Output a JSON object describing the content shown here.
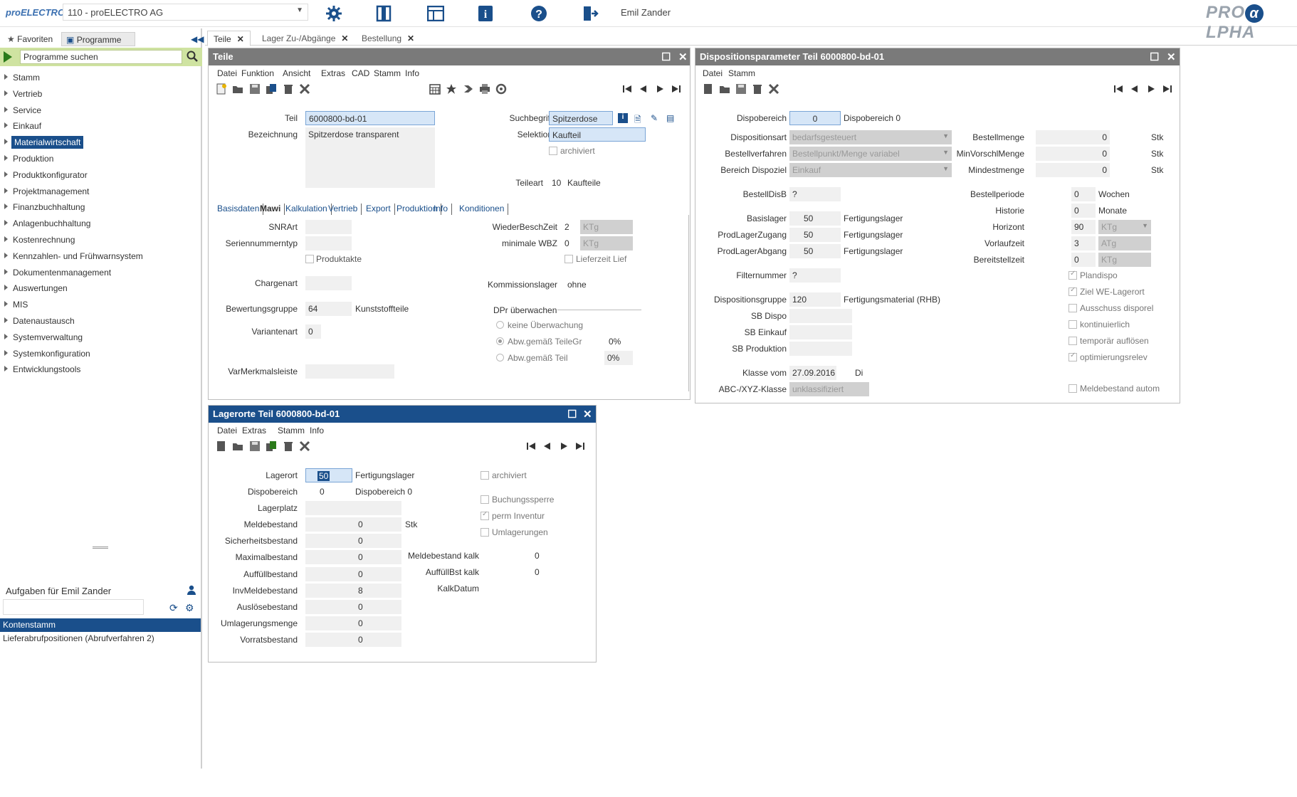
{
  "top": {
    "logo": "proELECTRO",
    "company": "110 - proELECTRO AG",
    "user": "Emil Zander",
    "brand_pre": "PRO",
    "brand_a": "α",
    "brand_post": "LPHA"
  },
  "left": {
    "tab_favorites": "Favoriten",
    "tab_programs": "Programme",
    "search_placeholder": "Programme suchen",
    "nav": [
      "Stamm",
      "Vertrieb",
      "Service",
      "Einkauf",
      "Materialwirtschaft",
      "Produktion",
      "Produktkonfigurator",
      "Projektmanagement",
      "Finanzbuchhaltung",
      "Anlagenbuchhaltung",
      "Kostenrechnung",
      "Kennzahlen- und Frühwarnsystem",
      "Dokumentenmanagement",
      "Auswertungen",
      "MIS",
      "Datenaustausch",
      "Systemverwaltung",
      "Systemkonfiguration",
      "Entwicklungstools"
    ],
    "tasks_title": "Aufgaben für Emil Zander",
    "tasks": [
      "Kontenstamm",
      "Lieferabrufpositionen (Abrufverfahren 2)"
    ]
  },
  "tabs": [
    "Teile",
    "Lager Zu-/Abgänge",
    "Bestellung"
  ],
  "teile": {
    "title": "Teile",
    "menu": [
      "Datei",
      "Funktion",
      "Ansicht",
      "Extras",
      "CAD",
      "Stamm",
      "Info"
    ],
    "teil_lbl": "Teil",
    "teil": "6000800-bd-01",
    "bez_lbl": "Bezeichnung",
    "bez": "Spitzerdose transparent",
    "such_lbl": "Suchbegriff",
    "such": "Spitzerdose",
    "sel_lbl": "Selektion",
    "sel": "Kaufteil",
    "archiviert": "archiviert",
    "teilart_lbl": "Teileart",
    "teilart": "10",
    "teilart_txt": "Kaufteile",
    "subtabs": [
      "Basisdaten",
      "Mawi",
      "Kalkulation",
      "Vertrieb",
      "Export",
      "Produktion",
      "Info",
      "Konditionen"
    ],
    "snr_lbl": "SNRArt",
    "sernr_lbl": "Seriennummerntyp",
    "produktakte": "Produktakte",
    "charg_lbl": "Chargenart",
    "bew_lbl": "Bewertungsgruppe",
    "bew": "64",
    "bew_txt": "Kunststoffteile",
    "var_lbl": "Variantenart",
    "var": "0",
    "varm_lbl": "VarMerkmalsleiste",
    "wbz_lbl": "WiederBeschZeit",
    "wbz": "2",
    "wbz_u": "KTg",
    "mwbz_lbl": "minimale WBZ",
    "mwbz": "0",
    "mwbz_u": "KTg",
    "lieferzeit": "Lieferzeit Lief",
    "kom_lbl": "Kommissionslager",
    "kom": "ohne",
    "dpr_lbl": "DPr überwachen",
    "r1": "keine Überwachung",
    "r2": "Abw.gemäß TeileGr",
    "r2v": "0%",
    "r3": "Abw.gemäß Teil",
    "r3v": "0%"
  },
  "dispo": {
    "title": "Dispositionsparameter  Teil 6000800-bd-01",
    "menu": [
      "Datei",
      "Stamm"
    ],
    "dbereich_lbl": "Dispobereich",
    "dbereich": "0",
    "dbereich_txt": "Dispobereich 0",
    "dart_lbl": "Dispositionsart",
    "dart": "bedarfsgesteuert",
    "bverf_lbl": "Bestellverfahren",
    "bverf": "Bestellpunkt/Menge variabel",
    "bdisp_lbl": "Bereich Dispoziel",
    "bdisp": "Einkauf",
    "bdisb_lbl": "BestellDisB",
    "bdisb": "?",
    "blag_lbl": "Basislager",
    "blag": "50",
    "blag_txt": "Fertigungslager",
    "pz_lbl": "ProdLagerZugang",
    "pz": "50",
    "pz_txt": "Fertigungslager",
    "pa_lbl": "ProdLagerAbgang",
    "pa": "50",
    "pa_txt": "Fertigungslager",
    "filt_lbl": "Filternummer",
    "filt": "?",
    "dgr_lbl": "Dispositionsgruppe",
    "dgr": "120",
    "dgr_txt": "Fertigungsmaterial (RHB)",
    "sbd_lbl": "SB Dispo",
    "sbe_lbl": "SB Einkauf",
    "sbp_lbl": "SB Produktion",
    "kl_lbl": "Klasse vom",
    "kl": "27.09.2016",
    "kl_day": "Di",
    "abc_lbl": "ABC-/XYZ-Klasse",
    "abc": "unklassifiziert",
    "bm_lbl": "Bestellmenge",
    "bm": "0",
    "bm_u": "Stk",
    "mvm_lbl": "MinVorschlMenge",
    "mvm": "0",
    "mvm_u": "Stk",
    "mm_lbl": "Mindestmenge",
    "mm": "0",
    "mm_u": "Stk",
    "bp_lbl": "Bestellperiode",
    "bp": "0",
    "bp_u": "Wochen",
    "hist_lbl": "Historie",
    "hist": "0",
    "hist_u": "Monate",
    "hor_lbl": "Horizont",
    "hor": "90",
    "hor_u": "KTg",
    "vl_lbl": "Vorlaufzeit",
    "vl": "3",
    "vl_u": "ATg",
    "bs_lbl": "Bereitstellzeit",
    "bs": "0",
    "bs_u": "KTg",
    "cbs": [
      "Plandispo",
      "Ziel WE-Lagerort",
      "Ausschuss disporel",
      "kontinuierlich",
      "temporär auflösen",
      "optimierungsrelev"
    ],
    "melde": "Meldebestand autom"
  },
  "lager": {
    "title": "Lagerorte Teil 6000800-bd-01",
    "menu": [
      "Datei",
      "Extras",
      "Stamm",
      "Info"
    ],
    "lo_lbl": "Lagerort",
    "lo": "50",
    "lo_txt": "Fertigungslager",
    "db_lbl": "Dispobereich",
    "db": "0",
    "db_txt": "Dispobereich 0",
    "lp_lbl": "Lagerplatz",
    "rows": [
      {
        "l": "Meldebestand",
        "v": "0"
      },
      {
        "l": "Sicherheitsbestand",
        "v": "0"
      },
      {
        "l": "Maximalbestand",
        "v": "0"
      },
      {
        "l": "Auffüllbestand",
        "v": "0"
      },
      {
        "l": "InvMeldebestand",
        "v": "8"
      },
      {
        "l": "Auslösebestand",
        "v": "0"
      },
      {
        "l": "Umlagerungsmenge",
        "v": "0"
      },
      {
        "l": "Vorratsbestand",
        "v": "0"
      }
    ],
    "stk": "Stk",
    "archiviert": "archiviert",
    "buchungssperre": "Buchungssperre",
    "perm": "perm Inventur",
    "umlag": "Umlagerungen",
    "mk_lbl": "Meldebestand kalk",
    "mk": "0",
    "ak_lbl": "AuffüllBst kalk",
    "ak": "0",
    "kd_lbl": "KalkDatum"
  }
}
